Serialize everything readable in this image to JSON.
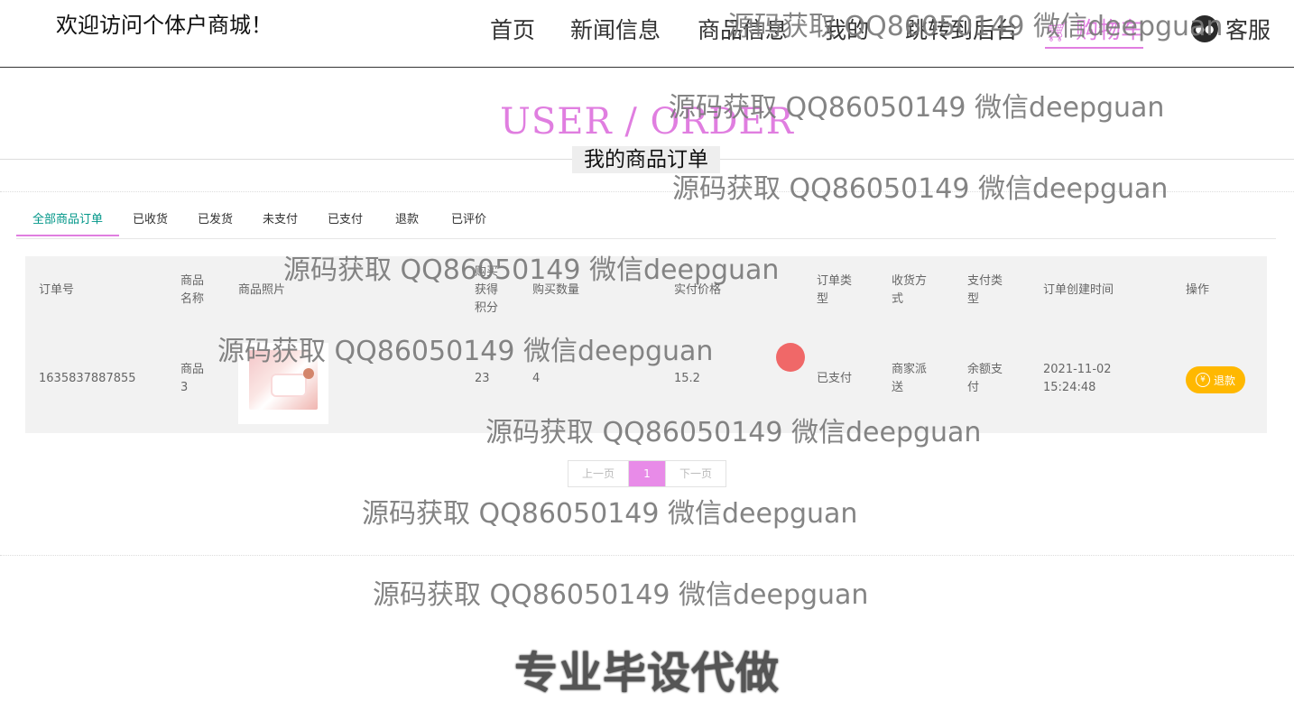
{
  "header": {
    "welcome": "欢迎访问个体户商城！",
    "nav": [
      "首页",
      "新闻信息",
      "商品信息",
      "我的",
      "跳转到后台"
    ],
    "cart_label": "购物车",
    "cart_icon": "cart-icon",
    "service_label": "客服",
    "service_icon": "wechat-icon",
    "accent_color": "#e07ee0"
  },
  "section": {
    "title_en": "USER / ORDER",
    "title_cn": "我的商品订单"
  },
  "tabs": [
    "全部商品订单",
    "已收货",
    "已发货",
    "未支付",
    "已支付",
    "退款",
    "已评价"
  ],
  "active_tab": "全部商品订单",
  "table": {
    "headers": {
      "order_no": "订单号",
      "name": "商品名称",
      "photo": "商品照片",
      "points": "购买获得积分",
      "qty": "购买数量",
      "price": "实付价格",
      "order_type": "订单类型",
      "delivery": "收货方式",
      "pay_type": "支付类型",
      "created": "订单创建时间",
      "action": "操作"
    },
    "rows": [
      {
        "order_no": "1635837887855",
        "name": "商品3",
        "points": "23",
        "qty": "4",
        "price": "15.2",
        "order_type": "已支付",
        "delivery": "商家派送",
        "pay_type": "余额支付",
        "created": "2021-11-02 15:24:48",
        "action_label": "退款",
        "action_icon": "yen-icon"
      }
    ]
  },
  "pagination": {
    "prev": "上一页",
    "current": "1",
    "next": "下一页",
    "accent_color": "#e88be8"
  },
  "refund_color": "#ffb800",
  "watermark": "源码获取 QQ86050149 微信deepguan",
  "promo": "专业毕设代做"
}
